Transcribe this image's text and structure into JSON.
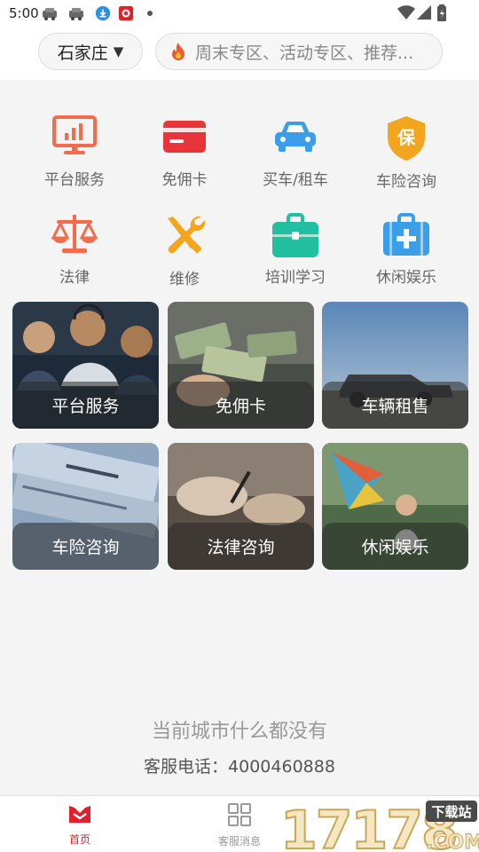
{
  "status_bar": {
    "time": "5:00"
  },
  "header": {
    "city": "石家庄",
    "city_caret": "▼",
    "search_placeholder": "周末专区、活动专区、推荐..."
  },
  "services": [
    {
      "label": "平台服务",
      "icon": "monitor-chart-icon",
      "color": "#f26b4a"
    },
    {
      "label": "免佣卡",
      "icon": "card-icon",
      "color": "#e8353a"
    },
    {
      "label": "买车/租车",
      "icon": "car-icon",
      "color": "#3b9ee8"
    },
    {
      "label": "车险咨询",
      "icon": "insurance-shield-icon",
      "color": "#f2a51d",
      "badge": "保"
    },
    {
      "label": "法律",
      "icon": "scales-icon",
      "color": "#f26b4a"
    },
    {
      "label": "维修",
      "icon": "repair-tools-icon",
      "color": "#f2a51d"
    },
    {
      "label": "培训学习",
      "icon": "briefcase-icon",
      "color": "#22c0a0"
    },
    {
      "label": "休闲娱乐",
      "icon": "medical-kit-icon",
      "color": "#3b9ee8"
    }
  ],
  "cards": [
    {
      "label": "平台服务"
    },
    {
      "label": "免佣卡"
    },
    {
      "label": "车辆租售"
    },
    {
      "label": "车险咨询"
    },
    {
      "label": "法律咨询"
    },
    {
      "label": "休闲娱乐"
    }
  ],
  "empty_message": "当前城市什么都没有",
  "service_phone": "客服电话：4000460888",
  "tabbar": {
    "home": "首页",
    "messages": "客服消息",
    "active_color": "#e0212a"
  },
  "watermark": {
    "text": "17178",
    "badge": "下载站",
    "suffix": ".COM"
  }
}
